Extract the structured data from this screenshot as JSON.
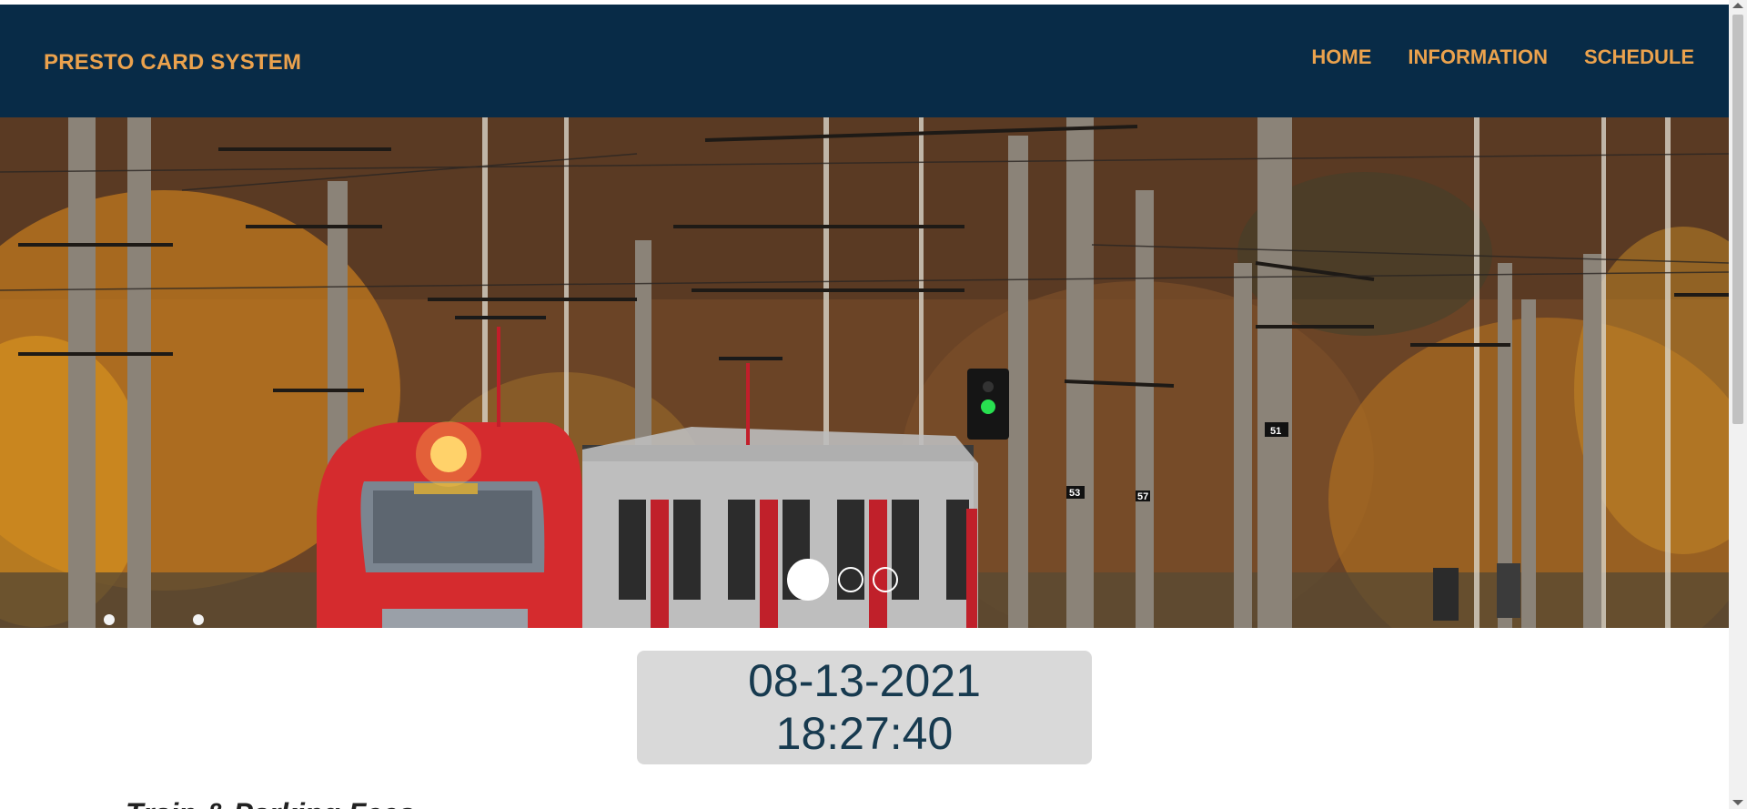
{
  "header": {
    "brand": "PRESTO CARD SYSTEM",
    "nav": [
      {
        "label": "HOME"
      },
      {
        "label": "INFORMATION"
      },
      {
        "label": "SCHEDULE"
      }
    ]
  },
  "carousel": {
    "slide_count": 3,
    "active_index": 0
  },
  "clock": {
    "date": "08-13-2021",
    "time": "18:27:40"
  },
  "section": {
    "heading": "Train & Parking Fees"
  }
}
